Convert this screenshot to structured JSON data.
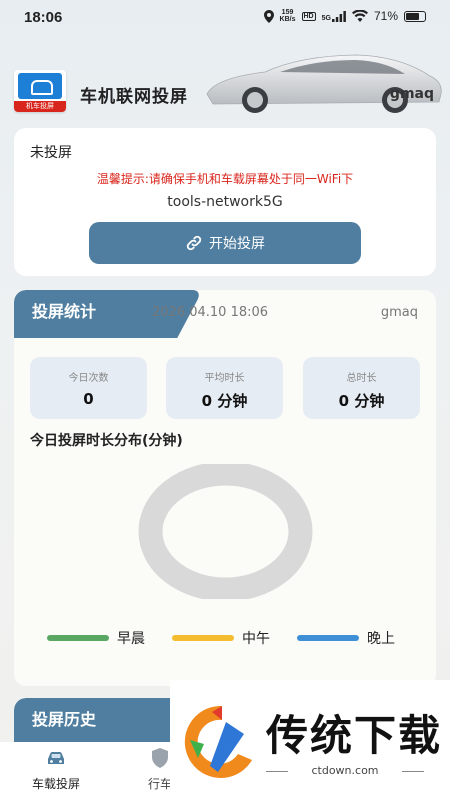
{
  "status_bar": {
    "time": "18:06",
    "net_speed_value": "159",
    "net_speed_unit": "KB/s",
    "hd": "HD",
    "signal_label": "5G",
    "battery": "71%"
  },
  "header": {
    "logo_text": "机车投屏",
    "title": "车机联网投屏",
    "user": "gmaq"
  },
  "cast": {
    "status": "未投屏",
    "tip": "温馨提示:请确保手机和车载屏幕处于同一WiFi下",
    "network": "tools-network5G",
    "button_label": "开始投屏"
  },
  "stats": {
    "section_title": "投屏统计",
    "datetime": "2026.04.10 18:06",
    "user": "gmaq",
    "boxes": [
      {
        "label": "今日次数",
        "value": "0"
      },
      {
        "label": "平均时长",
        "value": "0 分钟"
      },
      {
        "label": "总时长",
        "value": "0 分钟"
      }
    ],
    "distribution_title": "今日投屏时长分布(分钟)",
    "chart_colors": {
      "ring": "#d9d9d9",
      "morning": "#5aa764",
      "noon": "#f3bd2f",
      "evening": "#3e8fd6"
    },
    "legend": [
      {
        "label": "早晨",
        "color": "#5aa764"
      },
      {
        "label": "中午",
        "color": "#f3bd2f"
      },
      {
        "label": "晚上",
        "color": "#3e8fd6"
      }
    ]
  },
  "history": {
    "section_title": "投屏历史"
  },
  "bottom_nav": [
    {
      "label": "车载投屏",
      "icon": "car-icon",
      "active": true
    },
    {
      "label": "行车",
      "icon": "shield-icon",
      "active": false
    }
  ],
  "watermark": {
    "brand_text": "传统下载",
    "url": "ctdown.com"
  },
  "colors": {
    "accent": "#4f7ea0",
    "warning": "#d9261c"
  }
}
